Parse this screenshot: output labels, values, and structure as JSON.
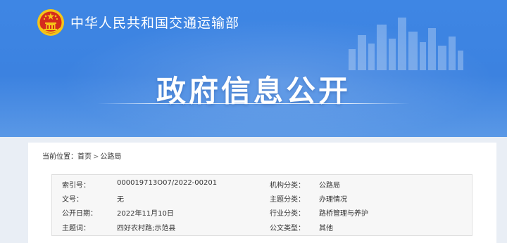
{
  "header": {
    "ministry_name": "中华人民共和国交通运输部",
    "page_heading": "政府信息公开"
  },
  "breadcrumb": {
    "label": "当前位置：",
    "items": [
      "首页",
      "公路局"
    ],
    "separator": ">"
  },
  "metadata": [
    {
      "label1": "索引号：",
      "value1": "000019713O07/2022-00201",
      "label2": "机构分类：",
      "value2": "公路局"
    },
    {
      "label1": "文号：",
      "value1": "无",
      "label2": "主题分类：",
      "value2": "办理情况"
    },
    {
      "label1": "公开日期：",
      "value1": "2022年11月10日",
      "label2": "行业分类：",
      "value2": "路桥管理与养护"
    },
    {
      "label1": "主题词：",
      "value1": "四好农村路;示范县",
      "label2": "公文类型：",
      "value2": "其他"
    }
  ],
  "colors": {
    "banner_blue": "#3e86e4",
    "emblem_red": "#d42b1e",
    "emblem_gold": "#f5c518"
  },
  "icons": {
    "emblem": "national-emblem-icon",
    "skyline": "city-skyline-decoration"
  }
}
